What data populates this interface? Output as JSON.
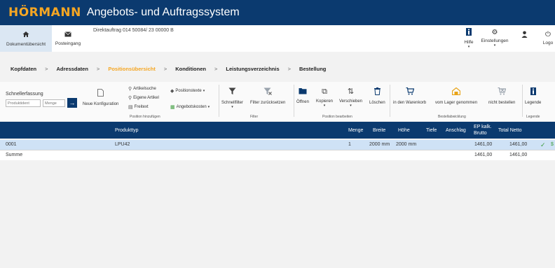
{
  "app": {
    "brand": "HÖRMANN",
    "title": "Angebots- und Auftragssystem"
  },
  "nav": {
    "dokumentuebersicht": "Dokumentübersicht",
    "posteingang": "Posteingang",
    "order_info": "Direktauftrag  014 50084/ 23  00000 B",
    "hilfe": "Hilfe",
    "einstellungen": "Einstellungen",
    "logout": "Logo"
  },
  "steps": [
    "Kopfdaten",
    "Adressdaten",
    "Positionsübersicht",
    "Konditionen",
    "Leistungsverzeichnis",
    "Bestellung"
  ],
  "steps_sep": ">",
  "ribbon": {
    "schnellerfassung": "Schnellerfassung",
    "produkt_placeholder": "Produktident",
    "menge_placeholder": "Menge",
    "go": "→",
    "neue_konfiguration": "Neue Konfiguration",
    "artikelsuche": "Artikelsuche",
    "eigene_artikel": "Eigene Artikel",
    "freitext": "Freitext",
    "positionstexte": "Positionstexte",
    "angebotskosten": "Angebotskosten",
    "group_position_hinzufuegen": "Position hinzufügen",
    "schnellfilter": "Schnellfilter",
    "filter_zuruecksetzen": "Filter zurücksetzen",
    "group_filter": "Filter",
    "oeffnen": "Öffnen",
    "kopieren": "Kopieren",
    "verschieben": "Verschieben",
    "loeschen": "Löschen",
    "group_position_bearbeiten": "Position bearbeiten",
    "in_den_warenkorb": "in den Warenkorb",
    "vom_lager": "vom Lager genommen",
    "nicht_bestellen": "nicht bestellen",
    "group_bestellabwicklung": "Bestellabwicklung",
    "legende": "Legende",
    "group_legende": "Legende"
  },
  "table": {
    "headers": {
      "produkttyp": "Produkttyp",
      "menge": "Menge",
      "breite": "Breite",
      "hoehe": "Höhe",
      "tiefe": "Tiefe",
      "anschlag": "Anschlag",
      "ep_kalk_1": "EP kalk.",
      "ep_kalk_2": "Brutto",
      "total_netto": "Total Netto"
    },
    "rows": [
      {
        "pos": "0001",
        "produkttyp": "LPU42",
        "menge": "1",
        "breite": "2000 mm",
        "hoehe": "2000 mm",
        "ep": "1461,00",
        "total": "1461,00",
        "status": "✓",
        "extra": "$"
      }
    ],
    "summe": {
      "label": "Summe",
      "ep": "1461,00",
      "total": "1461,00"
    }
  },
  "colors": {
    "navy": "#0b3a6f",
    "accent": "#f5a623",
    "selected_row": "#cfe2f6"
  }
}
